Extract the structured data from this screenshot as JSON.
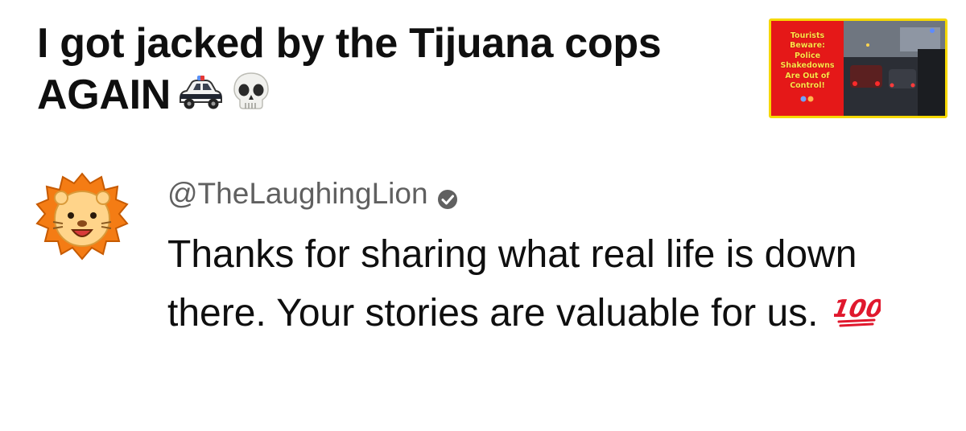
{
  "video": {
    "title": "I got jacked by the Tijuana cops AGAIN",
    "title_emojis": [
      "police-car-icon",
      "skull-icon"
    ],
    "thumbnail": {
      "text_lines": [
        "Tourists",
        "Beware:",
        "Police",
        "Shakedowns",
        "Are Out of",
        "Control!"
      ],
      "colors": {
        "panel": "#e51818",
        "text": "#ffe24a",
        "border": "#f6d800"
      }
    }
  },
  "comment": {
    "handle": "@TheLaughingLion",
    "verified": true,
    "text": "Thanks for sharing what real life is down there. Your stories are valuable for us.",
    "trailing_emoji": "hundred-points-icon",
    "avatar": "lion-avatar-icon"
  },
  "colors": {
    "title": "#0f0f0f",
    "handle": "#606060",
    "body": "#0f0f0f",
    "hundred": "#e0182d"
  }
}
